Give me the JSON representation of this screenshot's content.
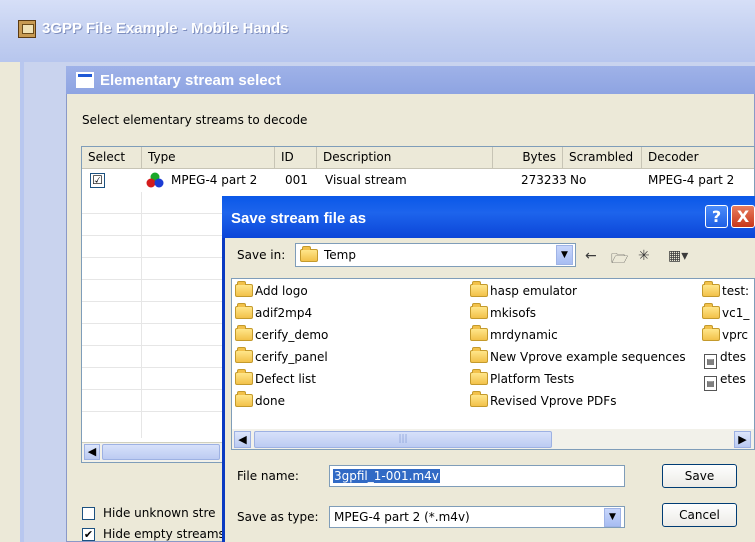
{
  "main_window": {
    "title": "3GPP File Example - Mobile Hands"
  },
  "stream_window": {
    "title": "Elementary stream select",
    "prompt": "Select elementary streams to decode",
    "columns": [
      "Select",
      "Type",
      "ID",
      "Description",
      "Bytes",
      "Scrambled",
      "Decoder"
    ],
    "rows": [
      {
        "selected": "☑",
        "type": "MPEG-4 part 2",
        "id": "001",
        "description": "Visual stream",
        "bytes": "273233",
        "scrambled": "No",
        "decoder": "MPEG-4 part 2"
      }
    ],
    "options": [
      {
        "label": "Hide unknown stre",
        "checked": ""
      },
      {
        "label": "Hide empty streams",
        "checked": "✔"
      }
    ]
  },
  "save_dialog": {
    "title": "Save stream file as",
    "help_label": "?",
    "close_label": "X",
    "save_in_label": "Save in:",
    "save_in_value": "Temp",
    "items_col1": [
      "Add logo",
      "adif2mp4",
      "cerify_demo",
      "cerify_panel",
      "Defect list",
      "done"
    ],
    "items_col2": [
      "hasp emulator",
      "mkisofs",
      "mrdynamic",
      "New Vprove example sequences",
      "Platform Tests",
      "Revised Vprove PDFs"
    ],
    "items_col3": [
      {
        "label": "test:",
        "kind": "folder"
      },
      {
        "label": "vc1_",
        "kind": "folder"
      },
      {
        "label": "vprc",
        "kind": "folder"
      },
      {
        "label": "dtes",
        "kind": "file"
      },
      {
        "label": "etes",
        "kind": "file"
      }
    ],
    "file_name_label": "File name:",
    "file_name_value": "3gpfil_1-001.m4v",
    "save_type_label": "Save as type:",
    "save_type_value": "MPEG-4 part 2 (*.m4v)",
    "save_button": "Save",
    "cancel_button": "Cancel"
  },
  "colors": {
    "titlebar_blue": "#0a58e8",
    "selection": "#316ac5",
    "close_red": "#c8361a"
  }
}
